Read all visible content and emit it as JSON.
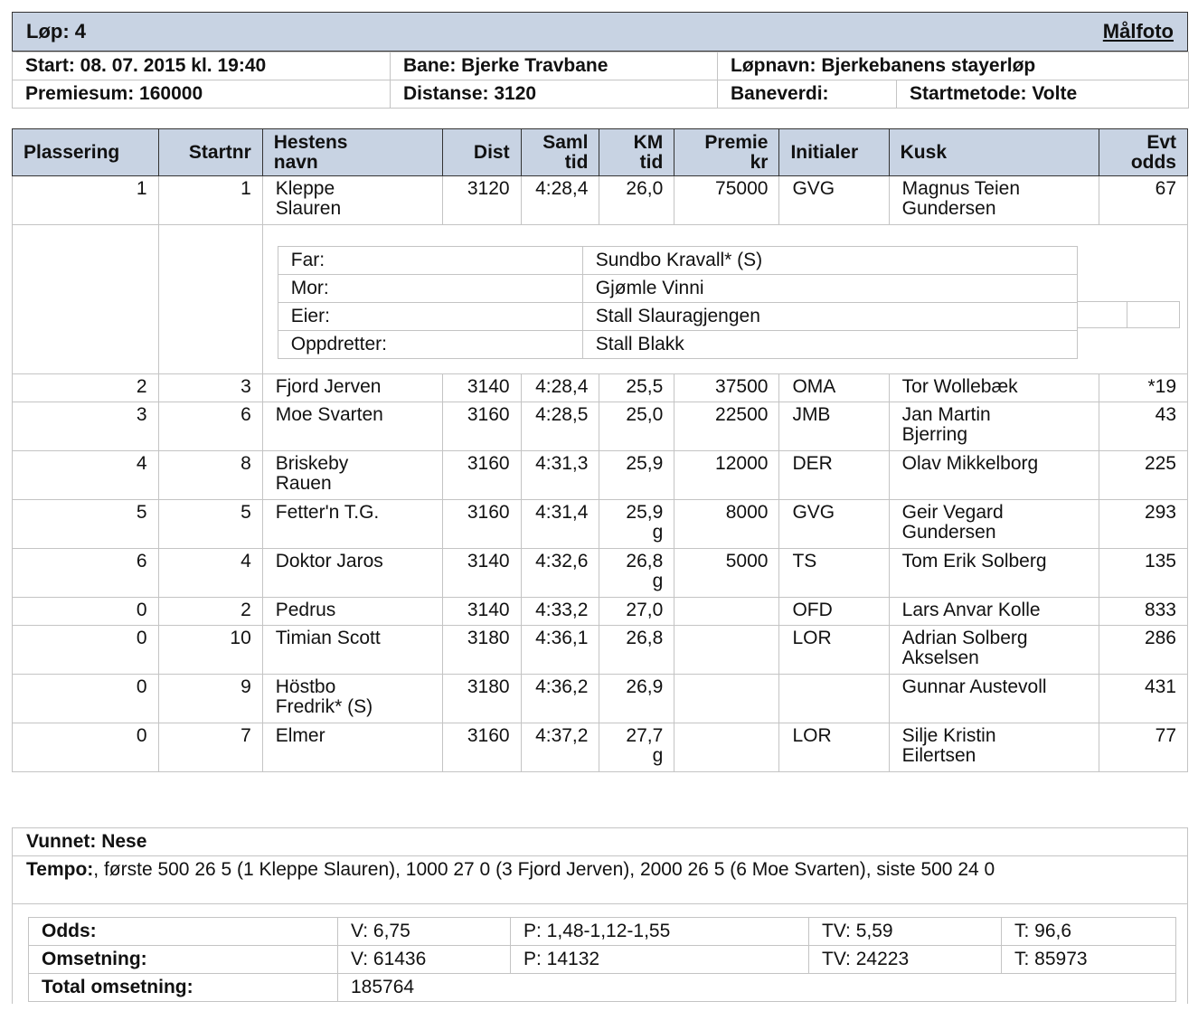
{
  "header": {
    "race_label": "Løp: 4",
    "photo_link": "Målfoto",
    "start": "Start: 08. 07. 2015 kl. 19:40",
    "track": "Bane: Bjerke Travbane",
    "race_name": "Løpnavn: Bjerkebanens stayerløp",
    "prize_sum": "Premiesum: 160000",
    "distance": "Distanse: 3120",
    "track_value": "Baneverdi:",
    "start_method": "Startmetode: Volte"
  },
  "results": {
    "columns": {
      "placering": "Plassering",
      "startnr": "Startnr",
      "name_1": "Hestens",
      "name_2": "navn",
      "dist": "Dist",
      "samltid_1": "Saml",
      "samltid_2": "tid",
      "kmtid_1": "KM",
      "kmtid_2": "tid",
      "premie_1": "Premie",
      "premie_2": "kr",
      "initialer": "Initialer",
      "kusk": "Kusk",
      "odds_1": "Evt",
      "odds_2": "odds"
    },
    "rows": [
      {
        "place": "1",
        "start": "1",
        "name_a": "Kleppe",
        "name_b": "Slauren",
        "dist": "3120",
        "total": "4:28,4",
        "km_a": "26,0",
        "km_b": "",
        "prize": "75000",
        "init": "GVG",
        "driver_a": "Magnus Teien",
        "driver_b": "Gundersen",
        "odds": "67"
      },
      {
        "place": "2",
        "start": "3",
        "name_a": "Fjord Jerven",
        "name_b": "",
        "dist": "3140",
        "total": "4:28,4",
        "km_a": "25,5",
        "km_b": "",
        "prize": "37500",
        "init": "OMA",
        "driver_a": "Tor Wollebæk",
        "driver_b": "",
        "odds": "*19"
      },
      {
        "place": "3",
        "start": "6",
        "name_a": "Moe Svarten",
        "name_b": "",
        "dist": "3160",
        "total": "4:28,5",
        "km_a": "25,0",
        "km_b": "",
        "prize": "22500",
        "init": "JMB",
        "driver_a": "Jan Martin",
        "driver_b": "Bjerring",
        "odds": "43"
      },
      {
        "place": "4",
        "start": "8",
        "name_a": "Briskeby",
        "name_b": "Rauen",
        "dist": "3160",
        "total": "4:31,3",
        "km_a": "25,9",
        "km_b": "",
        "prize": "12000",
        "init": "DER",
        "driver_a": "Olav Mikkelborg",
        "driver_b": "",
        "odds": "225"
      },
      {
        "place": "5",
        "start": "5",
        "name_a": "Fetter'n T.G.",
        "name_b": "",
        "dist": "3160",
        "total": "4:31,4",
        "km_a": "25,9",
        "km_b": "g",
        "prize": "8000",
        "init": "GVG",
        "driver_a": "Geir Vegard",
        "driver_b": "Gundersen",
        "odds": "293"
      },
      {
        "place": "6",
        "start": "4",
        "name_a": "Doktor Jaros",
        "name_b": "",
        "dist": "3140",
        "total": "4:32,6",
        "km_a": "26,8",
        "km_b": "g",
        "prize": "5000",
        "init": "TS",
        "driver_a": "Tom Erik Solberg",
        "driver_b": "",
        "odds": "135"
      },
      {
        "place": "0",
        "start": "2",
        "name_a": "Pedrus",
        "name_b": "",
        "dist": "3140",
        "total": "4:33,2",
        "km_a": "27,0",
        "km_b": "",
        "prize": "",
        "init": "OFD",
        "driver_a": "Lars Anvar Kolle",
        "driver_b": "",
        "odds": "833"
      },
      {
        "place": "0",
        "start": "10",
        "name_a": "Timian Scott",
        "name_b": "",
        "dist": "3180",
        "total": "4:36,1",
        "km_a": "26,8",
        "km_b": "",
        "prize": "",
        "init": "LOR",
        "driver_a": "Adrian Solberg",
        "driver_b": "Akselsen",
        "odds": "286"
      },
      {
        "place": "0",
        "start": "9",
        "name_a": "Höstbo",
        "name_b": "Fredrik* (S)",
        "dist": "3180",
        "total": "4:36,2",
        "km_a": "26,9",
        "km_b": "",
        "prize": "",
        "init": "",
        "driver_a": "Gunnar Austevoll",
        "driver_b": "",
        "odds": "431"
      },
      {
        "place": "0",
        "start": "7",
        "name_a": "Elmer",
        "name_b": "",
        "dist": "3160",
        "total": "4:37,2",
        "km_a": "27,7",
        "km_b": "g",
        "prize": "",
        "init": "LOR",
        "driver_a": "Silje Kristin",
        "driver_b": "Eilertsen",
        "odds": "77"
      }
    ]
  },
  "pedigree": [
    {
      "label": "Far:",
      "value": "Sundbo Kravall* (S)"
    },
    {
      "label": "Mor:",
      "value": "Gjømle Vinni"
    },
    {
      "label": "Eier:",
      "value": "Stall Slauragjengen"
    },
    {
      "label": "Oppdretter:",
      "value": "Stall Blakk"
    }
  ],
  "footer": {
    "won_by": "Vunnet: Nese",
    "tempo_label": "Tempo:",
    "tempo_text": ", første 500 26 5 (1 Kleppe Slauren), 1000 27 0 (3 Fjord Jerven), 2000 26 5 (6 Moe Svarten), siste 500 24 0",
    "odds_label": "Odds:",
    "odds_v": "V: 6,75",
    "odds_p": "P: 1,48-1,12-1,55",
    "odds_tv": "TV: 5,59",
    "odds_t": "T: 96,6",
    "turnover_label": "Omsetning:",
    "turnover_v": "V: 61436",
    "turnover_p": "P: 14132",
    "turnover_tv": "TV: 24223",
    "turnover_t": "T: 85973",
    "total_label": "Total omsetning:",
    "total_value": "185764"
  }
}
